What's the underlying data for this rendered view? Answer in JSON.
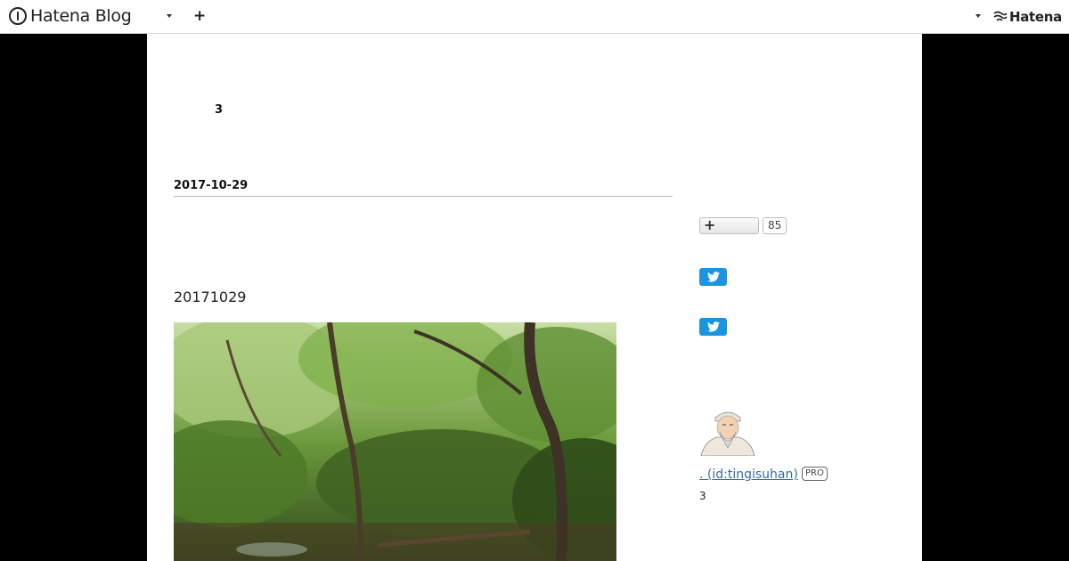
{
  "header": {
    "logo_text": "Hatena Blog",
    "add_label": "+",
    "right_brand": "Hatena"
  },
  "blog": {
    "description": "3"
  },
  "entry": {
    "date": "2017-10-29",
    "title": "20171029"
  },
  "sidebar": {
    "bookmark_plus": "+",
    "bookmark_count": "85",
    "profile_name": ". (id:tingisuhan)",
    "pro_label": "PRO",
    "profile_count": "3"
  },
  "icons": {
    "logo": "hatena-blog-logo-icon",
    "dropdown": "chevron-down-icon",
    "twitter": "twitter-icon"
  },
  "colors": {
    "twitter": "#1b95e0",
    "link": "#3a6ea5"
  }
}
